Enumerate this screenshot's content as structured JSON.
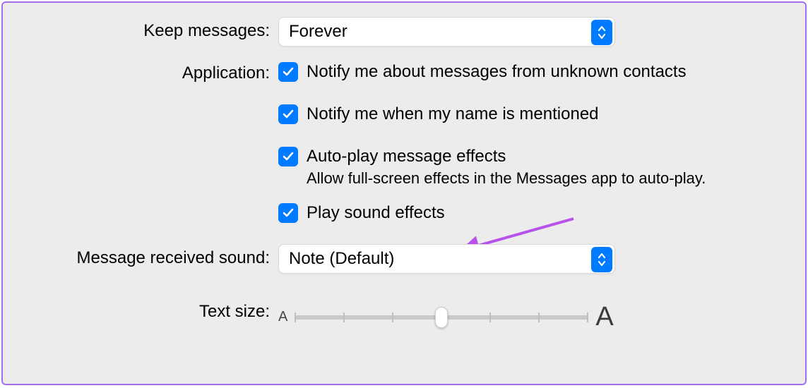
{
  "labels": {
    "keep_messages": "Keep messages:",
    "application": "Application:",
    "received_sound": "Message received sound:",
    "text_size": "Text size:"
  },
  "keep_messages": {
    "value": "Forever"
  },
  "application": {
    "notify_unknown": "Notify me about messages from unknown contacts",
    "notify_mentioned": "Notify me when my name is mentioned",
    "auto_play": "Auto-play message effects",
    "auto_play_desc": "Allow full-screen effects in the Messages app to auto-play.",
    "play_sound": "Play sound effects"
  },
  "received_sound": {
    "value": "Note (Default)"
  },
  "text_size": {
    "small": "A",
    "large": "A"
  }
}
